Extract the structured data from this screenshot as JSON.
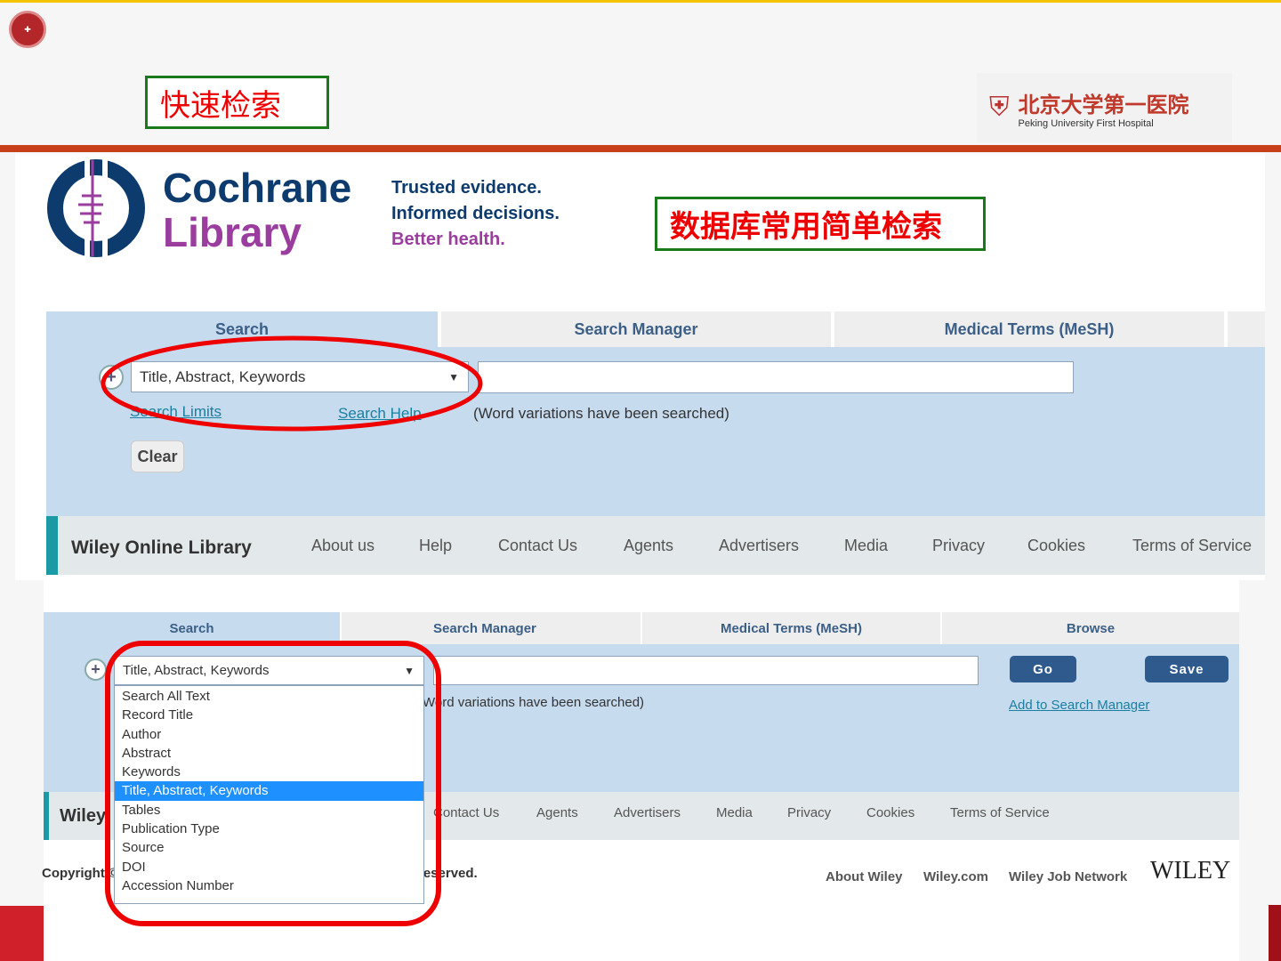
{
  "slide": {
    "title_box": "快速检索",
    "subtitle_box": "数据库常用简单检索",
    "hospital_name_cn": "北京大学第一医院",
    "hospital_name_en": "Peking University First Hospital",
    "colors": {
      "annotation_red": "#ee0000",
      "box_green": "#1a7a1a",
      "accent": "#c8401a"
    }
  },
  "cochrane": {
    "logo_line1": "Cochrane",
    "logo_line2": "Library",
    "tagline1": "Trusted evidence.",
    "tagline2": "Informed decisions.",
    "tagline3": "Better health."
  },
  "top_screenshot": {
    "tabs": [
      "Search",
      "Search Manager",
      "Medical Terms (MeSH)"
    ],
    "select_value": "Title, Abstract, Keywords",
    "search_limits": "Search Limits",
    "search_help": "Search Help",
    "note": "(Word variations have been searched)",
    "clear": "Clear",
    "footer_brand": "Wiley Online Library",
    "footer_links": [
      "About us",
      "Help",
      "Contact Us",
      "Agents",
      "Advertisers",
      "Media",
      "Privacy",
      "Cookies",
      "Terms of Service"
    ]
  },
  "bottom_screenshot": {
    "tabs": [
      "Search",
      "Search Manager",
      "Medical Terms (MeSH)",
      "Browse"
    ],
    "select_value": "Title, Abstract, Keywords",
    "options": [
      "Search All Text",
      "Record Title",
      "Author",
      "Abstract",
      "Keywords",
      "Title, Abstract, Keywords",
      "Tables",
      "Publication Type",
      "Source",
      "DOI",
      "Accession Number"
    ],
    "note": "(Word variations have been searched)",
    "go": "Go",
    "save": "Save",
    "add_to_manager": "Add to Search Manager",
    "footer_brand": "Wiley",
    "footer_links": [
      "Contact Us",
      "Agents",
      "Advertisers",
      "Media",
      "Privacy",
      "Cookies",
      "Terms of Service"
    ],
    "copyright_left": "Copyright ©",
    "copyright_right": "reserved.",
    "bottom_links": [
      "About Wiley",
      "Wiley.com",
      "Wiley Job Network"
    ],
    "wiley_logo": "WILEY"
  }
}
